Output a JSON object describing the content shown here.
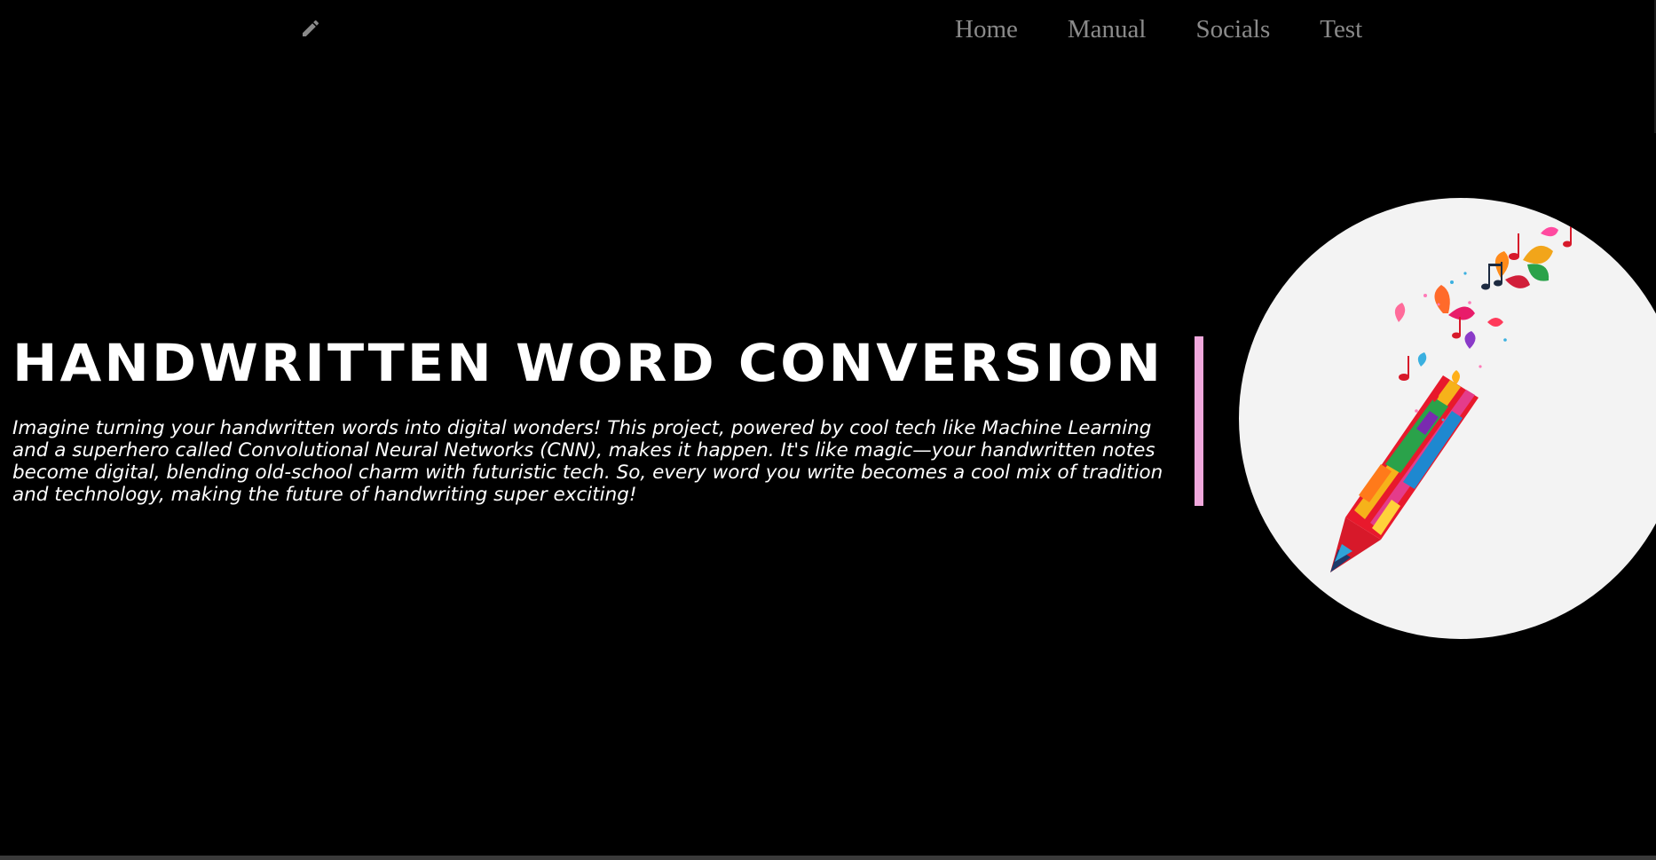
{
  "nav": {
    "logo_icon": "pencil-icon",
    "links": [
      "Home",
      "Manual",
      "Socials",
      "Test"
    ]
  },
  "hero": {
    "title": "HANDWRITTEN WORD CONVERSION",
    "description": "Imagine turning your handwritten words into digital wonders! This project, powered by cool tech like Machine Learning and a superhero called Convolutional Neural Networks (CNN), makes it happen. It's like magic—your handwritten notes become digital, blending old-school charm with futuristic tech. So, every word you write becomes a cool mix of tradition and technology, making the future of handwriting super exciting!",
    "image_icon": "colorful-pencil-butterflies-illustration"
  },
  "colors": {
    "background": "#000000",
    "nav_link": "#8a8a8a",
    "accent_divider": "#f0a8dc",
    "image_circle": "#f3f3f3"
  }
}
